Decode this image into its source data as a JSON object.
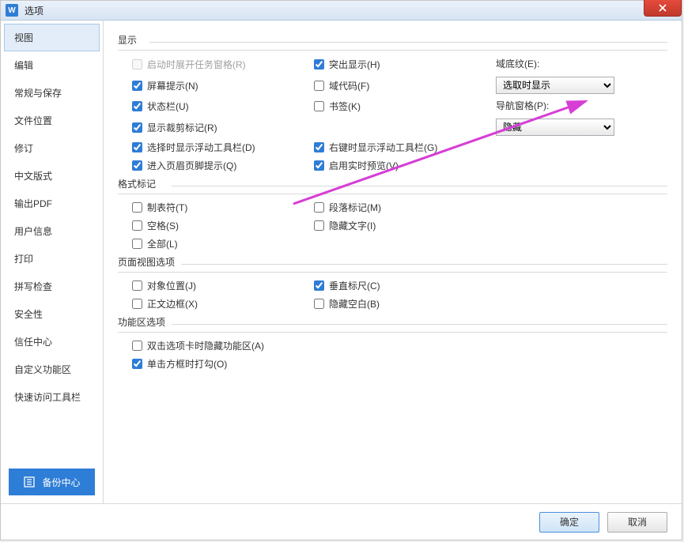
{
  "title": "选项",
  "close_icon": "close",
  "sidebar": {
    "items": [
      {
        "label": "视图",
        "active": true
      },
      {
        "label": "编辑"
      },
      {
        "label": "常规与保存"
      },
      {
        "label": "文件位置"
      },
      {
        "label": "修订"
      },
      {
        "label": "中文版式"
      },
      {
        "label": "输出PDF"
      },
      {
        "label": "用户信息"
      },
      {
        "label": "打印"
      },
      {
        "label": "拼写检查"
      },
      {
        "label": "安全性"
      },
      {
        "label": "信任中心"
      },
      {
        "label": "自定义功能区"
      },
      {
        "label": "快速访问工具栏"
      }
    ],
    "backup_label": "备份中心"
  },
  "groups": {
    "display": {
      "title": "显示",
      "items": {
        "startup_taskpane": "启动时展开任务窗格(R)",
        "screen_tips": "屏幕提示(N)",
        "status_bar": "状态栏(U)",
        "crop_marks": "显示裁剪标记(R)",
        "floating_toolbar_select": "选择时显示浮动工具栏(D)",
        "header_footer_hint": "进入页眉页脚提示(Q)",
        "highlight": "突出显示(H)",
        "field_codes": "域代码(F)",
        "bookmarks": "书签(K)",
        "floating_toolbar_rclick": "右键时显示浮动工具栏(G)",
        "live_preview": "启用实时预览(V)",
        "field_shading_label": "域底纹(E):",
        "field_shading_value": "选取时显示",
        "nav_pane_label": "导航窗格(P):",
        "nav_pane_value": "隐藏"
      }
    },
    "format_marks": {
      "title": "格式标记",
      "items": {
        "tabs": "制表符(T)",
        "spaces": "空格(S)",
        "all": "全部(L)",
        "paragraph": "段落标记(M)",
        "hidden_text": "隐藏文字(I)"
      }
    },
    "page_view": {
      "title": "页面视图选项",
      "items": {
        "object_position": "对象位置(J)",
        "text_border": "正文边框(X)",
        "vertical_ruler": "垂直标尺(C)",
        "hide_blank": "隐藏空白(B)"
      }
    },
    "ribbon": {
      "title": "功能区选项",
      "items": {
        "dblclick_hide": "双击选项卡时隐藏功能区(A)",
        "click_check": "单击方框时打勾(O)"
      }
    }
  },
  "buttons": {
    "ok": "确定",
    "cancel": "取消"
  }
}
